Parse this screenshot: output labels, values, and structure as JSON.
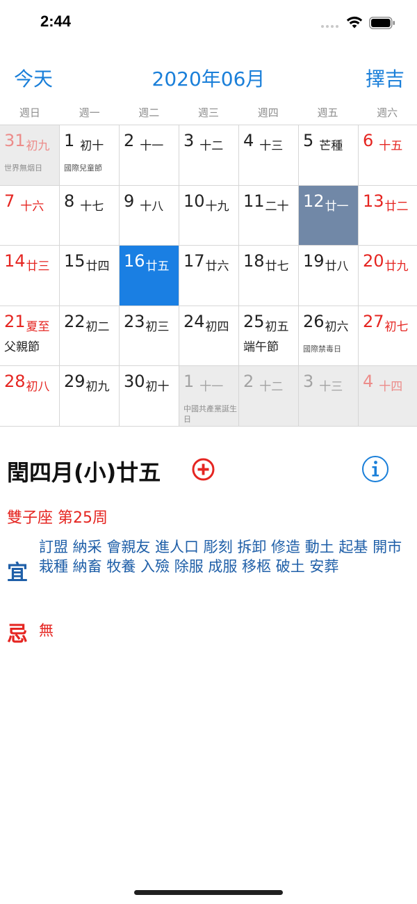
{
  "status_bar": {
    "time": "2:44"
  },
  "header": {
    "today_label": "今天",
    "title": "2020年06月",
    "select_label": "擇吉"
  },
  "weekdays": [
    "週日",
    "週一",
    "週二",
    "週三",
    "週四",
    "週五",
    "週六"
  ],
  "calendar": {
    "cells": [
      {
        "day": "31",
        "lunar": "初九",
        "note": "世界無烟日",
        "other": true,
        "red": true
      },
      {
        "day": "1",
        "lunar": "初十",
        "note": "國際兒童節"
      },
      {
        "day": "2",
        "lunar": "十一"
      },
      {
        "day": "3",
        "lunar": "十二"
      },
      {
        "day": "4",
        "lunar": "十三"
      },
      {
        "day": "5",
        "lunar": "芒種"
      },
      {
        "day": "6",
        "lunar": "十五",
        "red": true
      },
      {
        "day": "7",
        "lunar": "十六",
        "red": true
      },
      {
        "day": "8",
        "lunar": "十七"
      },
      {
        "day": "9",
        "lunar": "十八"
      },
      {
        "day": "10",
        "lunar": "十九"
      },
      {
        "day": "11",
        "lunar": "二十"
      },
      {
        "day": "12",
        "lunar": "廿一",
        "selected": true
      },
      {
        "day": "13",
        "lunar": "廿二",
        "red": true
      },
      {
        "day": "14",
        "lunar": "廿三",
        "red": true
      },
      {
        "day": "15",
        "lunar": "廿四"
      },
      {
        "day": "16",
        "lunar": "廿五",
        "today": true
      },
      {
        "day": "17",
        "lunar": "廿六"
      },
      {
        "day": "18",
        "lunar": "廿七"
      },
      {
        "day": "19",
        "lunar": "廿八"
      },
      {
        "day": "20",
        "lunar": "廿九",
        "red": true
      },
      {
        "day": "21",
        "lunar": "夏至",
        "note": "父親節",
        "red": true,
        "big_note": true
      },
      {
        "day": "22",
        "lunar": "初二"
      },
      {
        "day": "23",
        "lunar": "初三"
      },
      {
        "day": "24",
        "lunar": "初四"
      },
      {
        "day": "25",
        "lunar": "初五",
        "note": "端午節",
        "big_note": true
      },
      {
        "day": "26",
        "lunar": "初六",
        "note": "國際禁毒日"
      },
      {
        "day": "27",
        "lunar": "初七",
        "red": true
      },
      {
        "day": "28",
        "lunar": "初八",
        "red": true
      },
      {
        "day": "29",
        "lunar": "初九"
      },
      {
        "day": "30",
        "lunar": "初十"
      },
      {
        "day": "1",
        "lunar": "十一",
        "note": "中國共產黨誕生日",
        "other": true
      },
      {
        "day": "2",
        "lunar": "十二",
        "other": true
      },
      {
        "day": "3",
        "lunar": "十三",
        "other": true
      },
      {
        "day": "4",
        "lunar": "十四",
        "other": true,
        "red": true
      }
    ]
  },
  "detail": {
    "lunar_date": "閏四月(小)廿五",
    "zodiac_week": "雙子座 第25周",
    "yi_label": "宜",
    "yi_items": "訂盟 納采 會親友 進人口 彫刻 拆卸 修造 動土 起基 開市 栽種 納畜 牧養 入殮 除服 成服 移柩 破土 安葬",
    "ji_label": "忌",
    "ji_items": "無"
  },
  "icons": {
    "add": "plus-circle-icon",
    "info": "info-circle-icon"
  },
  "colors": {
    "accent": "#1a7fd9",
    "holiday_red": "#e52521",
    "today": "#1a7fe3",
    "selected": "#7188a7",
    "yi_blue": "#1f5fa8"
  }
}
